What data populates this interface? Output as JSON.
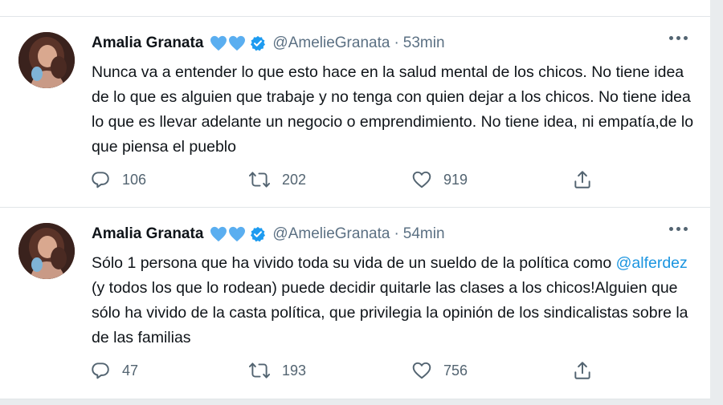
{
  "tweets": [
    {
      "author_name": "Amalia Granata",
      "handle": "@AmelieGranata",
      "separator": "·",
      "time": "53min",
      "text": "Nunca va a entender lo que esto hace en la salud mental de los chicos. No tiene idea de lo que es alguien que trabaje y no tenga con quien dejar a los chicos. No tiene idea lo que es llevar adelante un negocio o emprendimiento. No tiene idea, ni empatía,de lo que piensa el pueblo",
      "replies": "106",
      "retweets": "202",
      "likes": "919"
    },
    {
      "author_name": "Amalia Granata",
      "handle": "@AmelieGranata",
      "separator": "·",
      "time": "54min",
      "text_before": "Sólo 1 persona que ha vivido toda su vida de un sueldo de la política como ",
      "mention": "@alferdez",
      "text_after": " (y todos los que lo rodean) puede decidir quitarle las clases a los chicos!Alguien que sólo ha vivido de la casta política, que privilegia la opinión de los sindicalistas sobre la de las familias",
      "replies": "47",
      "retweets": "193",
      "likes": "756"
    }
  ],
  "icons": {
    "hearts": "blue-heart-icon",
    "verified": "verified-badge-icon",
    "more": "more-icon",
    "reply": "reply-icon",
    "retweet": "retweet-icon",
    "like": "like-icon",
    "share": "share-icon"
  },
  "colors": {
    "heart_blue": "#5aaef0",
    "verified_blue": "#1d9bf0",
    "mention_blue": "#1b95e0",
    "secondary_text": "#5b7083"
  }
}
